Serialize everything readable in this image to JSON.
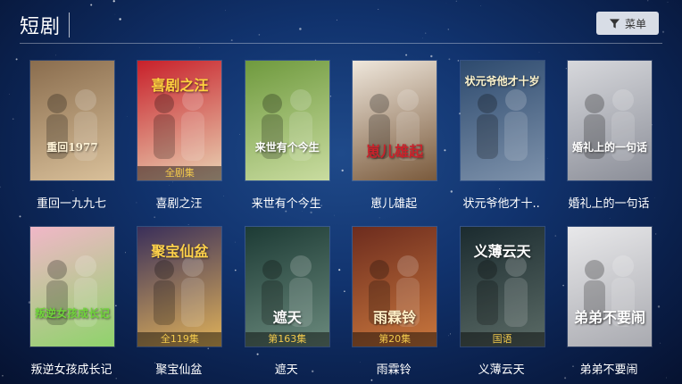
{
  "header": {
    "title": "短剧",
    "menu_label": "菜单",
    "menu_icon": "filter-icon"
  },
  "dramas": [
    {
      "name": "重回一九九七",
      "poster_title": "重回1977",
      "badge": "",
      "colors": [
        "#8a6d4e",
        "#d9c09a"
      ],
      "title_color": "#fff3d6"
    },
    {
      "name": "喜剧之汪",
      "poster_title": "喜剧之汪",
      "badge": "全剧集",
      "colors": [
        "#c8202a",
        "#e9d2b3"
      ],
      "title_color": "#ffd23f"
    },
    {
      "name": "来世有个今生",
      "poster_title": "来世有个今生",
      "badge": "",
      "colors": [
        "#6f9a3e",
        "#c9dca0"
      ],
      "title_color": "#ffffff"
    },
    {
      "name": "崽儿雄起",
      "poster_title": "崽儿雄起",
      "badge": "",
      "colors": [
        "#efe7dc",
        "#7a5a3c"
      ],
      "title_color": "#c9222b"
    },
    {
      "name": "状元爷他才十..",
      "poster_title": "状元爷他才十岁",
      "badge": "",
      "colors": [
        "#2d4a6e",
        "#7f93ac"
      ],
      "title_color": "#fff5cc"
    },
    {
      "name": "婚礼上的一句话",
      "poster_title": "婚礼上的一句话",
      "badge": "",
      "colors": [
        "#d7d8dc",
        "#8b8e98"
      ],
      "title_color": "#ffffff"
    },
    {
      "name": "叛逆女孩成长记",
      "poster_title": "叛逆女孩成长记",
      "badge": "",
      "colors": [
        "#f1b7c8",
        "#8fd36b"
      ],
      "title_color": "#6fd43a"
    },
    {
      "name": "聚宝仙盆",
      "poster_title": "聚宝仙盆",
      "badge": "全119集",
      "colors": [
        "#3a2f5a",
        "#e0b25a"
      ],
      "title_color": "#ffd24a"
    },
    {
      "name": "遮天",
      "poster_title": "遮天",
      "badge": "第163集",
      "colors": [
        "#1d3b35",
        "#6b8a7d"
      ],
      "title_color": "#ffffff"
    },
    {
      "name": "雨霖铃",
      "poster_title": "雨霖铃",
      "badge": "第20集",
      "colors": [
        "#6d2c1e",
        "#c9773d"
      ],
      "title_color": "#fff0c8"
    },
    {
      "name": "义薄云天",
      "poster_title": "义薄云天",
      "badge": "国语",
      "colors": [
        "#1b2b2f",
        "#5b6b66"
      ],
      "title_color": "#ffffff"
    },
    {
      "name": "弟弟不要闹",
      "poster_title": "弟弟不要闹",
      "badge": "",
      "colors": [
        "#e8e8ea",
        "#a9aab0"
      ],
      "title_color": "#ffffff"
    }
  ]
}
